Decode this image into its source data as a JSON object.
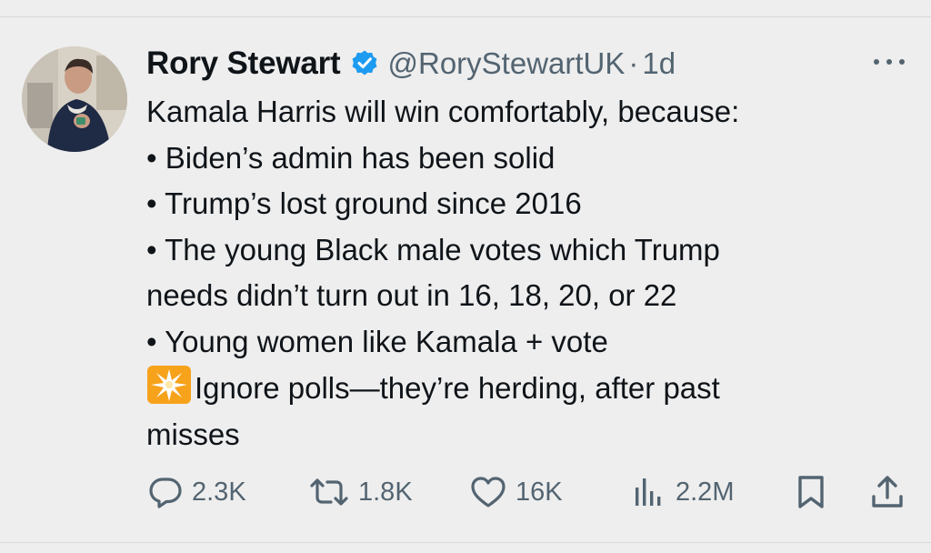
{
  "tweet": {
    "author_name": "Rory Stewart",
    "handle": "@RoryStewartUK",
    "separator": "·",
    "time": "1d",
    "lines": [
      "Kamala Harris will win comfortably, because:",
      "• Biden’s admin has been solid",
      "• Trump’s lost ground since 2016",
      "• The young Black male votes which Trump",
      "needs didn’t turn out in 16, 18, 20, or 22",
      "• Young women like Kamala + vote"
    ],
    "emoji_line_text": "Ignore polls—they’re herding, after past",
    "last_line": "misses"
  },
  "actions": {
    "replies": "2.3K",
    "retweets": "1.8K",
    "likes": "16K",
    "views": "2.2M"
  },
  "icons": {
    "verified": "verified-badge-icon",
    "more": "more-options-icon",
    "reply": "reply-icon",
    "retweet": "retweet-icon",
    "like": "heart-icon",
    "views": "views-icon",
    "bookmark": "bookmark-icon",
    "share": "share-icon",
    "emoji": "collision-emoji-icon"
  },
  "colors": {
    "background": "#eeeeee",
    "text": "#0f1419",
    "secondary": "#536471",
    "verified": "#1d9bf0"
  }
}
